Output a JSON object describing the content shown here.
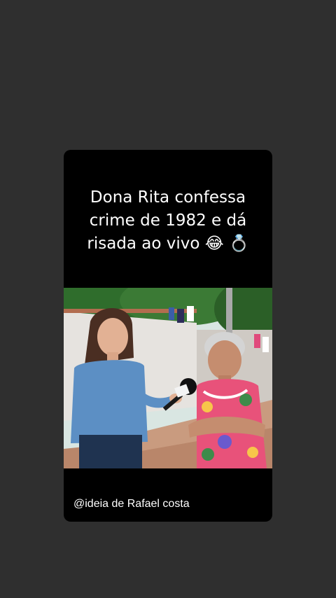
{
  "story": {
    "headline": "Dona Rita confessa\ncrime de 1982 e dá\nrisada ao vivo  😂  💍",
    "credit": "@ideia de Rafael costa"
  },
  "photo": {
    "scene": "street-interview",
    "colors": {
      "sky": "#d9e6e2",
      "foliage": "#2f6d2c",
      "wall": "#e6e3df",
      "ground": "#b9866a",
      "shirt": "#5c8fc4",
      "dress": "#e8527a"
    }
  }
}
